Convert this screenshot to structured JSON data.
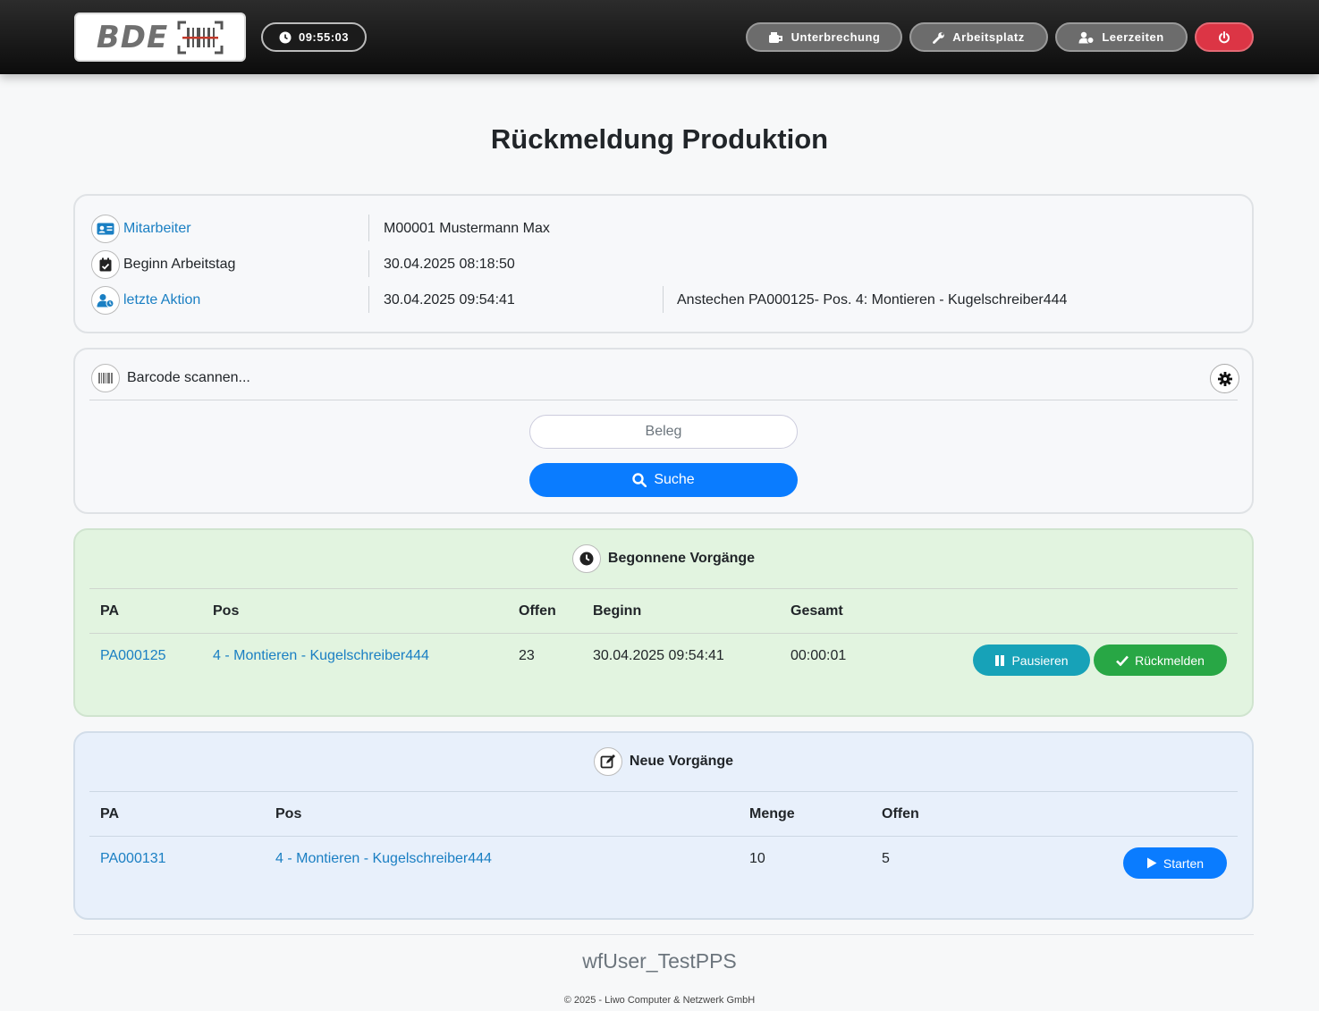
{
  "header": {
    "logo_text": "BDE",
    "clock": "09:55:03",
    "buttons": {
      "unterbrechung": "Unterbrechung",
      "arbeitsplatz": "Arbeitsplatz",
      "leerzeiten": "Leerzeiten"
    }
  },
  "page_title": "Rückmeldung Produktion",
  "info": {
    "mitarbeiter_label": "Mitarbeiter",
    "mitarbeiter_value": "M00001 Mustermann Max",
    "beginn_label": "Beginn Arbeitstag",
    "beginn_value": "30.04.2025 08:18:50",
    "aktion_label": "letzte Aktion",
    "aktion_time": "30.04.2025 09:54:41",
    "aktion_text": "Anstechen PA000125- Pos. 4: Montieren - Kugelschreiber444"
  },
  "scan": {
    "label": "Barcode scannen...",
    "beleg_placeholder": "Beleg",
    "search_label": "Suche"
  },
  "begonnene": {
    "title": "Begonnene Vorgänge",
    "headers": {
      "pa": "PA",
      "pos": "Pos",
      "offen": "Offen",
      "beginn": "Beginn",
      "gesamt": "Gesamt"
    },
    "rows": [
      {
        "pa": "PA000125",
        "pos": "4 - Montieren - Kugelschreiber444",
        "offen": "23",
        "beginn": "30.04.2025 09:54:41",
        "gesamt": "00:00:01"
      }
    ],
    "pause_label": "Pausieren",
    "rueckmelden_label": "Rückmelden"
  },
  "neue": {
    "title": "Neue Vorgänge",
    "headers": {
      "pa": "PA",
      "pos": "Pos",
      "menge": "Menge",
      "offen": "Offen"
    },
    "rows": [
      {
        "pa": "PA000131",
        "pos": "4 - Montieren - Kugelschreiber444",
        "menge": "10",
        "offen": "5"
      }
    ],
    "start_label": "Starten"
  },
  "footer": {
    "user": "wfUser_TestPPS",
    "copyright": "© 2025 - Liwo Computer & Netzwerk GmbH"
  },
  "colors": {
    "primary": "#0a7cff",
    "pause": "#17a2b8",
    "success": "#28a745",
    "danger": "#dc3545",
    "begonnene_bg": "#e2f4e0",
    "neue_bg": "#e8f0fb"
  }
}
